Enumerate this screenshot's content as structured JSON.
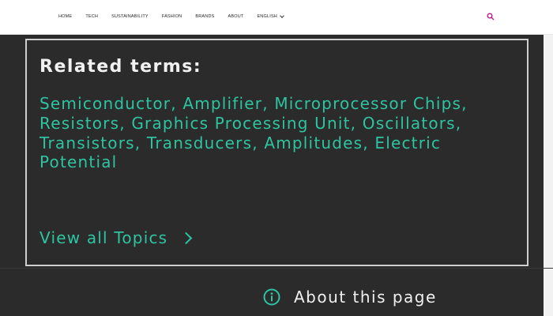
{
  "nav": {
    "items": [
      {
        "label": "HOME"
      },
      {
        "label": "TECH"
      },
      {
        "label": "SUSTAINABILITY"
      },
      {
        "label": "FASHION"
      },
      {
        "label": "BRANDS"
      },
      {
        "label": "ABOUT"
      },
      {
        "label": "ENGLISH"
      }
    ],
    "search_icon": "search-icon",
    "accent": "#c0188f"
  },
  "panel": {
    "title": "Related terms:",
    "terms": "Semiconductor, Amplifier, Microprocessor Chips, Resistors, Graphics Processing Unit, Oscillators, Transistors, Transducers, Amplitudes, Electric Potential",
    "view_all_label": "View all Topics"
  },
  "footer": {
    "about_label": "About this page",
    "info_icon": "info-icon"
  },
  "colors": {
    "background": "#2b2b2b",
    "link": "#2ec4a0",
    "text": "#f1f1f1"
  }
}
